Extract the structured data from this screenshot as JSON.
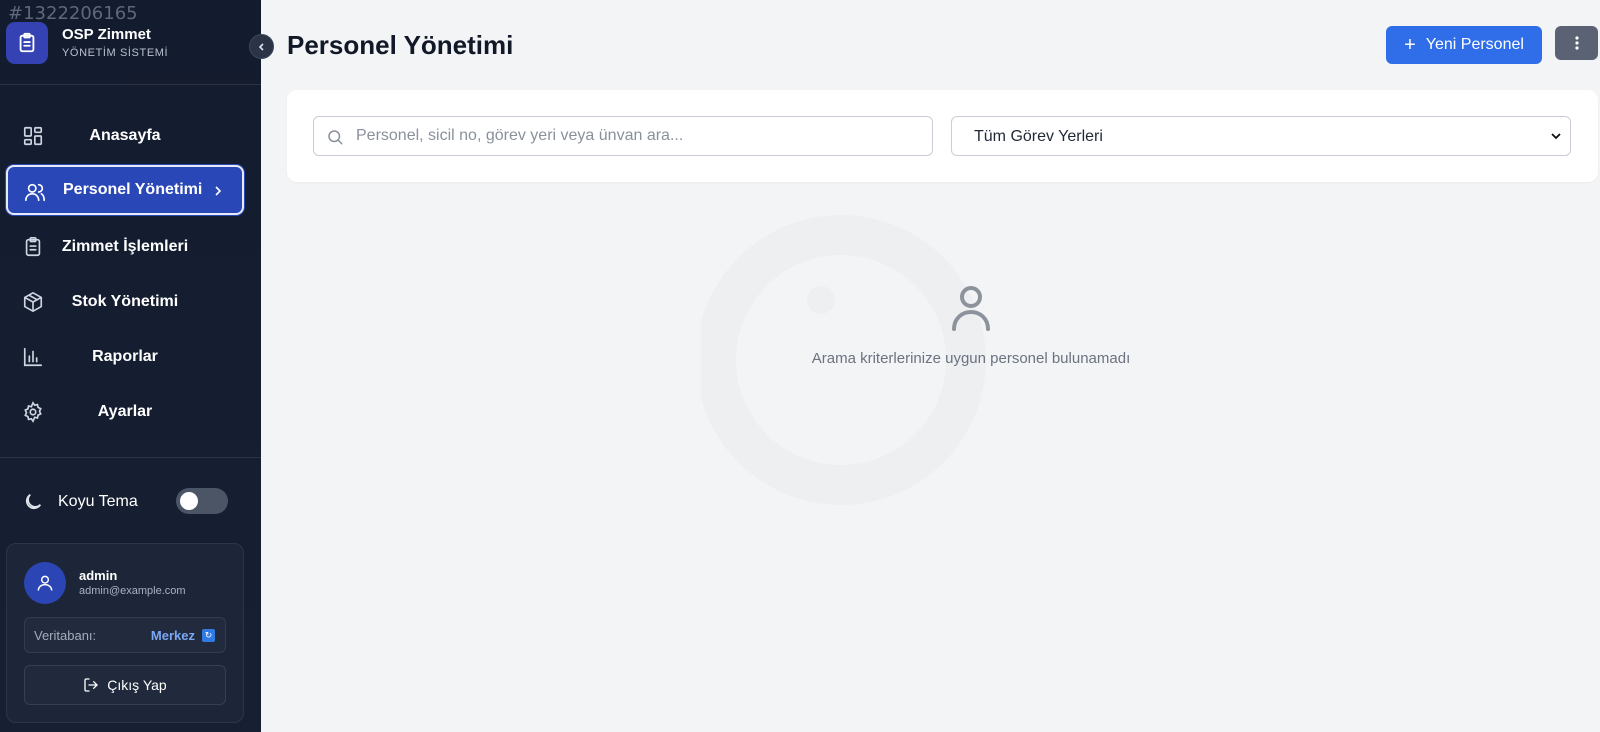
{
  "watermark_id": "#1322206165",
  "brand": {
    "title": "OSP Zimmet",
    "subtitle": "YÖNETİM SİSTEMİ"
  },
  "nav": [
    {
      "label": "Anasayfa",
      "icon": "dashboard-icon",
      "active": false
    },
    {
      "label": "Personel Yönetimi",
      "icon": "users-icon",
      "active": true
    },
    {
      "label": "Zimmet İşlemleri",
      "icon": "clipboard-icon",
      "active": false
    },
    {
      "label": "Stok Yönetimi",
      "icon": "package-icon",
      "active": false
    },
    {
      "label": "Raporlar",
      "icon": "bar-chart-icon",
      "active": false
    },
    {
      "label": "Ayarlar",
      "icon": "gear-icon",
      "active": false
    }
  ],
  "theme": {
    "label": "Koyu Tema",
    "enabled": false
  },
  "user": {
    "name": "admin",
    "email": "admin@example.com",
    "db_label": "Veritabanı:",
    "db_value": "Merkez",
    "logout_label": "Çıkış Yap"
  },
  "header": {
    "title": "Personel Yönetimi",
    "new_button": "Yeni Personel"
  },
  "filters": {
    "search_placeholder": "Personel, sicil no, görev yeri veya ünvan ara...",
    "search_value": "",
    "location_selected": "Tüm Görev Yerleri"
  },
  "empty_state": {
    "message": "Arama kriterlerinize uygun personel bulunamadı"
  },
  "colors": {
    "sidebar_bg": "#131c2e",
    "accent": "#2f6ee8",
    "active_nav": "#2a47b8",
    "page_bg": "#f3f4f6"
  }
}
